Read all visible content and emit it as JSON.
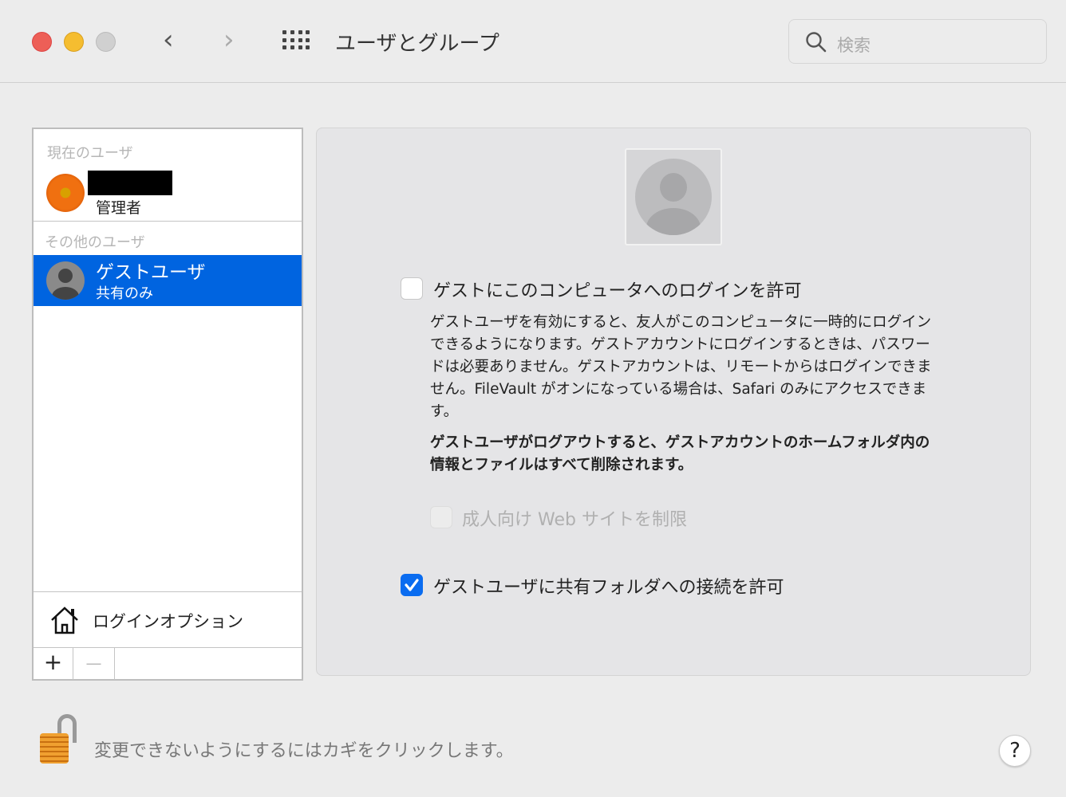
{
  "window": {
    "title": "ユーザとグループ",
    "search_placeholder": "検索"
  },
  "sidebar": {
    "current_header": "現在のユーザ",
    "current_user": {
      "role": "管理者"
    },
    "other_header": "その他のユーザ",
    "guest": {
      "name": "ゲストユーザ",
      "subtitle": "共有のみ"
    },
    "login_options": "ログインオプション",
    "add": "+",
    "remove": "—"
  },
  "main": {
    "allow_login": {
      "label": "ゲストにこのコンピュータへのログインを許可",
      "checked": false
    },
    "description_lines": [
      "ゲストユーザを有効にすると、友人がこのコンピュータに一時的にログイン",
      "できるようになります。ゲストアカウントにログインするときは、パスワー",
      "ドは必要ありません。ゲストアカウントは、リモートからはログインできま",
      "せん。FileVault がオンになっている場合は、Safari のみにアクセスできま",
      "す。"
    ],
    "warning_lines": [
      "ゲストユーザがログアウトすると、ゲストアカウントのホームフォルダ内の",
      "情報とファイルはすべて削除されます。"
    ],
    "restrict_adult": {
      "label": "成人向け Web サイトを制限",
      "checked": false,
      "enabled": false
    },
    "shared_folders": {
      "label": "ゲストユーザに共有フォルダへの接続を許可",
      "checked": true
    }
  },
  "footer": {
    "lock_text": "変更できないようにするにはカギをクリックします。",
    "help": "?"
  },
  "colors": {
    "accent": "#0064e0"
  }
}
